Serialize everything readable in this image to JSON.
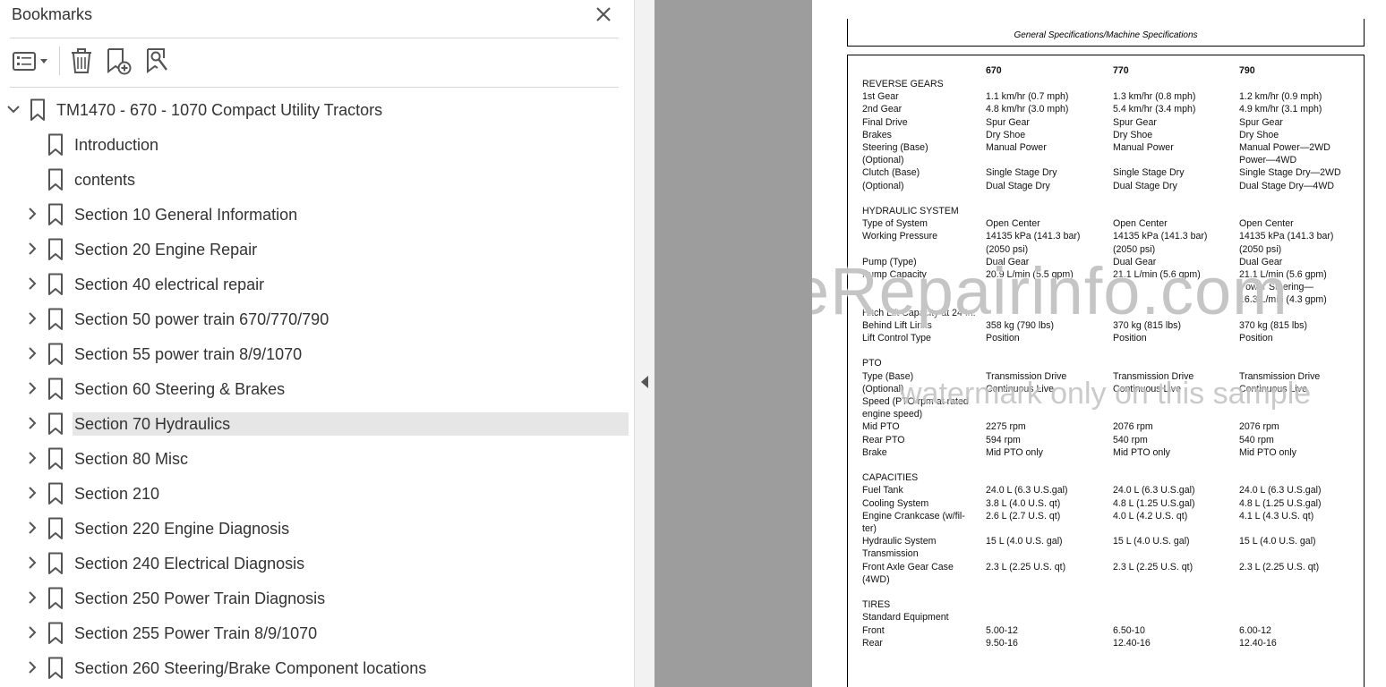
{
  "panel": {
    "title": "Bookmarks",
    "toolbar": [
      "options-menu",
      "delete-bookmark",
      "add-bookmark",
      "find-bookmark"
    ],
    "root": "TM1470 - 670 - 1070 Compact Utility Tractors",
    "items": [
      "Introduction",
      "contents",
      "Section 10 General Information",
      "Section 20 Engine Repair",
      "Section 40 electrical repair",
      "Section 50 power train 670/770/790",
      "Section 55 power train 8/9/1070",
      "Section 60 Steering & Brakes",
      "Section 70 Hydraulics",
      "Section 80 Misc",
      "Section 210",
      "Section 220 Engine Diagnosis",
      "Section 240 Electrical Diagnosis",
      "Section 250 Power Train Diagnosis",
      "Section 255 Power Train 8/9/1070",
      "Section 260 Steering/Brake Component locations"
    ],
    "selected_index": 8,
    "expandable": [
      false,
      false,
      true,
      true,
      true,
      true,
      true,
      true,
      true,
      true,
      true,
      true,
      true,
      true,
      true,
      true
    ]
  },
  "document": {
    "header": "General Specifications/Machine Specifications",
    "columns": [
      "670",
      "770",
      "790"
    ],
    "lines": [
      {
        "t": "REVERSE GEARS"
      },
      {
        "l": "1st Gear",
        "a": "1.1 km/hr (0.7 mph)",
        "b": "1.3 km/hr (0.8 mph)",
        "c": "1.2 km/hr (0.9 mph)"
      },
      {
        "l": "2nd Gear",
        "a": "4.8 km/hr (3.0 mph)",
        "b": "5.4 km/hr (3.4 mph)",
        "c": "4.9 km/hr (3.1 mph)"
      },
      {
        "l": "Final Drive",
        "a": "Spur Gear",
        "b": "Spur Gear",
        "c": "Spur Gear"
      },
      {
        "l": "Brakes",
        "a": "Dry Shoe",
        "b": "Dry Shoe",
        "c": "Dry Shoe"
      },
      {
        "l": "Steering (Base)",
        "a": "Manual Power",
        "b": "Manual Power",
        "c": "Manual Power—2WD"
      },
      {
        "l": "(Optional)",
        "c": "Power—4WD"
      },
      {
        "l": "Clutch (Base)",
        "a": "Single Stage Dry",
        "b": "Single Stage Dry",
        "c": "Single Stage Dry—2WD"
      },
      {
        "l": "(Optional)",
        "a": "Dual Stage Dry",
        "b": "Dual Stage Dry",
        "c": "Dual Stage Dry—4WD"
      },
      {
        "gap": 1
      },
      {
        "t": "HYDRAULIC SYSTEM"
      },
      {
        "l": "Type of System",
        "a": "Open Center",
        "b": "Open Center",
        "c": "Open Center"
      },
      {
        "l": "Working Pressure",
        "a": "14135 kPa (141.3 bar)",
        "b": "14135 kPa (141.3 bar)",
        "c": "14135 kPa (141.3 bar)"
      },
      {
        "a": "(2050 psi)",
        "b": "(2050 psi)",
        "c": "(2050 psi)"
      },
      {
        "l": "Pump (Type)",
        "a": "Dual Gear",
        "b": "Dual Gear",
        "c": "Dual Gear"
      },
      {
        "l": "Pump Capacity",
        "a": "20.9 L/min (5.5 gpm)",
        "b": "21.1 L/min (5.6 gpm)",
        "c": "21.1 L/min (5.6 gpm)"
      },
      {
        "c": "Power Steering—"
      },
      {
        "c": "16.3 L/min (4.3 gpm)"
      },
      {
        "l": "Hitch Lift Capacity at 24 In."
      },
      {
        "l": "Behind Lift Links",
        "a": "358 kg (790 lbs)",
        "b": "370 kg (815 lbs)",
        "c": "370 kg (815 lbs)"
      },
      {
        "l": "Lift Control Type",
        "a": "Position",
        "b": "Position",
        "c": "Position"
      },
      {
        "gap": 1
      },
      {
        "t": "PTO"
      },
      {
        "l": "Type (Base)",
        "a": "Transmission Drive",
        "b": "Transmission Drive",
        "c": "Transmission Drive"
      },
      {
        "l": "(Optional)",
        "a": "Continuous Live",
        "b": "Continuous Live",
        "c": "Continuous Live"
      },
      {
        "l": "Speed (PTO rpm at rated"
      },
      {
        "l": "engine speed)"
      },
      {
        "l": "Mid PTO",
        "a": "2275 rpm",
        "b": "2076 rpm",
        "c": "2076 rpm"
      },
      {
        "l": "Rear PTO",
        "a": "594 rpm",
        "b": "540 rpm",
        "c": "540 rpm"
      },
      {
        "l": "Brake",
        "a": "Mid PTO only",
        "b": "Mid PTO only",
        "c": "Mid PTO only"
      },
      {
        "gap": 1
      },
      {
        "t": "CAPACITIES"
      },
      {
        "l": "Fuel Tank",
        "a": "24.0 L (6.3 U.S.gal)",
        "b": "24.0 L (6.3 U.S.gal)",
        "c": "24.0 L (6.3 U.S.gal)"
      },
      {
        "l": "Cooling System",
        "a": "3.8 L (4.0 U.S. qt)",
        "b": "4.8 L (1.25 U.S.gal)",
        "c": "4.8 L (1.25 U.S.gal)"
      },
      {
        "l": "Engine Crankcase (w/fil-",
        "a": "2.6 L (2.7 U.S. qt)",
        "b": "4.0 L (4.2 U.S. qt)",
        "c": "4.1 L (4.3 U.S. qt)"
      },
      {
        "l": "ter)"
      },
      {
        "l": "Hydraulic System",
        "a": "15 L (4.0 U.S. gal)",
        "b": "15 L (4.0 U.S. gal)",
        "c": "15 L (4.0 U.S. gal)"
      },
      {
        "l": "Transmission"
      },
      {
        "l": "Front Axle Gear Case",
        "a": "2.3 L (2.25 U.S. qt)",
        "b": "2.3 L (2.25 U.S. qt)",
        "c": "2.3 L (2.25 U.S. qt)"
      },
      {
        "l": "(4WD)"
      },
      {
        "gap": 1
      },
      {
        "t": "TIRES"
      },
      {
        "l": "Standard Equipment"
      },
      {
        "l": "Front",
        "a": "5.00-12",
        "b": "6.50-10",
        "c": "6.00-12"
      },
      {
        "l": "Rear",
        "a": "9.50-16",
        "b": "12.40-16",
        "c": "12.40-16"
      }
    ],
    "watermark": "eRepairinfo.com",
    "watermark_note": "watermark only on this sample"
  }
}
